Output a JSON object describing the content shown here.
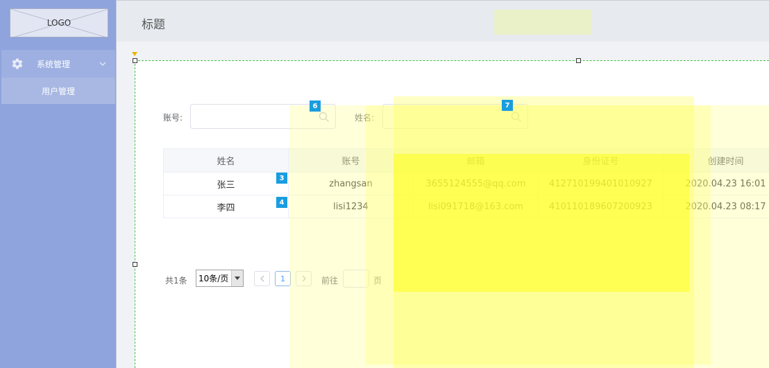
{
  "sidebar": {
    "logo": "LOGO",
    "menu": {
      "title": "系统管理",
      "icon": "gear-icon",
      "items": [
        {
          "label": "用户管理"
        }
      ]
    }
  },
  "header": {
    "title": "标题"
  },
  "search": {
    "account_label": "账号:",
    "name_label": "姓名:",
    "account_value": "",
    "name_value": ""
  },
  "badges": [
    "6",
    "7",
    "3",
    "4"
  ],
  "table": {
    "columns": [
      "姓名",
      "账号",
      "邮箱",
      "身份证号",
      "创建时间"
    ],
    "rows": [
      [
        "张三",
        "zhangsan",
        "3655124555@qq.com",
        "412710199401010927",
        "2020.04.23 16:01"
      ],
      [
        "李四",
        "lisi1234",
        "lisi091718@163.com",
        "410110189607200923",
        "2020.04.23 08:17"
      ]
    ]
  },
  "pagination": {
    "total": "共1条",
    "page_size": "10条/页",
    "current_page": "1",
    "goto_label": "前往",
    "goto_unit": "页",
    "goto_value": ""
  },
  "colors": {
    "sidebar_bg": "#8fa3dc",
    "highlight": "#ffff00",
    "badge": "#1a9de0",
    "selection_border": "#3cc43c"
  }
}
